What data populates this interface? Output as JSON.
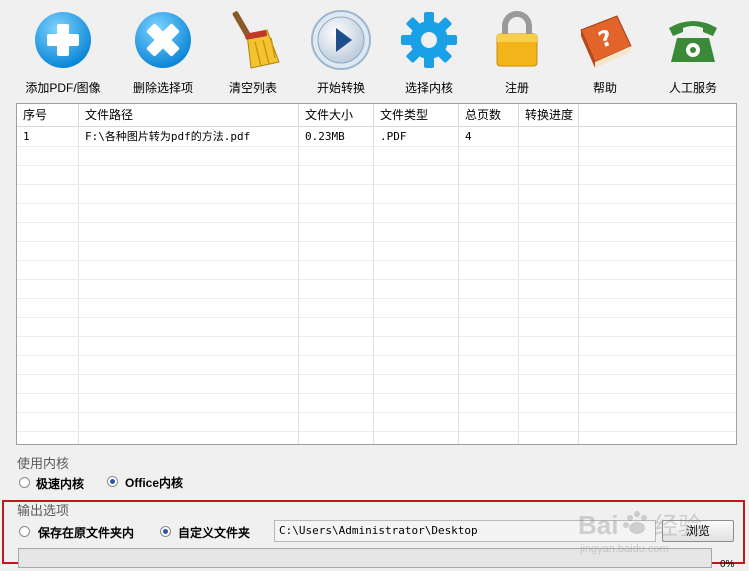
{
  "toolbar": {
    "add_label": "添加PDF/图像",
    "delete_label": "删除选择项",
    "clear_label": "清空列表",
    "start_label": "开始转换",
    "kernel_label": "选择内核",
    "register_label": "注册",
    "help_label": "帮助",
    "service_label": "人工服务"
  },
  "table": {
    "headers": [
      "序号",
      "文件路径",
      "文件大小",
      "文件类型",
      "总页数",
      "转换进度"
    ],
    "rows": [
      [
        "1",
        "F:\\各种图片转为pdf的方法.pdf",
        "0.23MB",
        ".PDF",
        "4",
        ""
      ]
    ]
  },
  "engine": {
    "title": "使用内核",
    "options": [
      "极速内核",
      "Office内核"
    ],
    "selected": "Office内核"
  },
  "output": {
    "title": "输出选项",
    "options": [
      "保存在原文件夹内",
      "自定义文件夹"
    ],
    "selected": "自定义文件夹",
    "path": "C:\\Users\\Administrator\\Desktop",
    "browse_label": "浏览",
    "progress_percent": 0,
    "progress_text": "0%"
  },
  "colors": {
    "accent_blue": "#1e9be0",
    "highlight_red": "#c4161c",
    "service_green": "#3a8a3a"
  },
  "watermark": {
    "brand": "Bai",
    "text": "经验",
    "subtext": "jingyan.baidu.com"
  }
}
